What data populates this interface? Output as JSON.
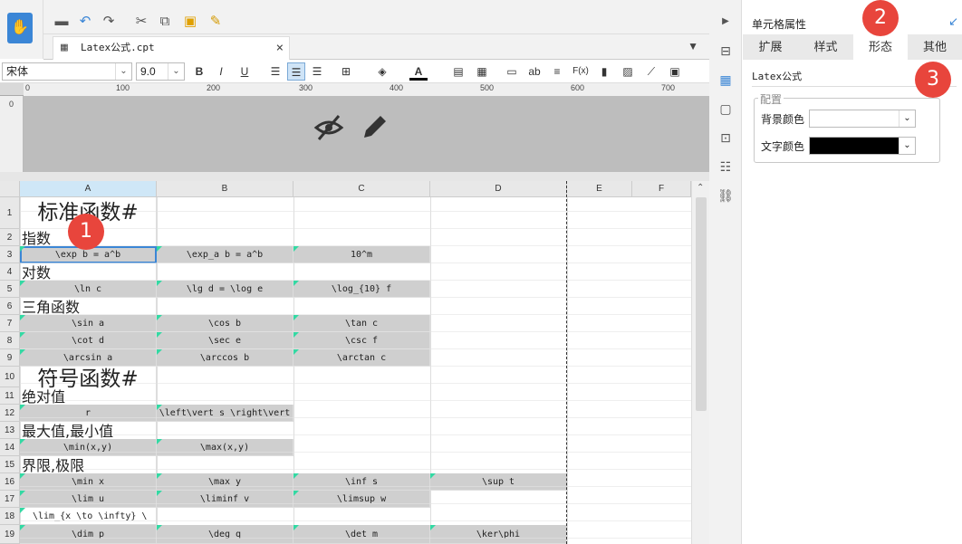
{
  "toolbar": {
    "undo": "↶",
    "redo": "↷",
    "save": "💾",
    "cut": "✂",
    "copy": "⧉",
    "paste": "📋",
    "brush": "🖌"
  },
  "file_tab": {
    "name": "Latex公式.cpt",
    "close": "×"
  },
  "format": {
    "font": "宋体",
    "size": "9.0",
    "bold": "B",
    "italic": "I",
    "underline": "U",
    "text_btn": "ab",
    "fx": "F(x)"
  },
  "ruler": {
    "ticks": [
      "0",
      "100",
      "200",
      "300",
      "400",
      "500",
      "600",
      "700"
    ]
  },
  "columns": [
    "A",
    "B",
    "C",
    "D",
    "E",
    "F"
  ],
  "rows": [
    "1",
    "2",
    "3",
    "4",
    "5",
    "6",
    "7",
    "8",
    "9",
    "10",
    "11",
    "12",
    "13",
    "14",
    "15",
    "16",
    "17",
    "18",
    "19"
  ],
  "cells": {
    "r1a": "标准函数#",
    "r2a": "指数",
    "r3a": "\\exp b = a^b",
    "r3b": "\\exp_a b = a^b",
    "r3c": "10^m",
    "r4a": "对数",
    "r5a": "\\ln c",
    "r5b": "\\lg d = \\log e",
    "r5c": "\\log_{10} f",
    "r6a": "三角函数",
    "r7a": "\\sin a",
    "r7b": "\\cos b",
    "r7c": "\\tan c",
    "r8a": "\\cot d",
    "r8b": "\\sec e",
    "r8c": "\\csc f",
    "r9a": "\\arcsin a",
    "r9b": "\\arccos b",
    "r9c": "\\arctan c",
    "r10a": "符号函数#",
    "r11a": "绝对值",
    "r12a": "r",
    "r12b": "\\left\\vert s \\right\\vert",
    "r13a": "最大值,最小值",
    "r14a": "\\min(x,y)",
    "r14b": "\\max(x,y)",
    "r15a": "界限,极限",
    "r16a": "\\min x",
    "r16b": "\\max y",
    "r16c": "\\inf s",
    "r16d": "\\sup t",
    "r17a": "\\lim u",
    "r17b": "\\liminf v",
    "r17c": "\\limsup w",
    "r18a": "\\lim_{x \\to \\infty} \\",
    "r19a": "\\dim p",
    "r19b": "\\deg q",
    "r19c": "\\det m",
    "r19d": "\\ker\\phi"
  },
  "panel": {
    "title": "单元格属性",
    "tabs": [
      "扩展",
      "样式",
      "形态",
      "其他"
    ],
    "active_tab": "形态",
    "type_value": "Latex公式",
    "group_label": "配置",
    "bg_label": "背景颜色",
    "text_label": "文字颜色",
    "text_color": "#000000"
  },
  "badges": [
    "1",
    "2",
    "3"
  ],
  "colors": {
    "accent": "#3b86d6",
    "badge": "#e8453c",
    "cell_gray": "#cfcfcf",
    "marker": "#33d9a3"
  }
}
